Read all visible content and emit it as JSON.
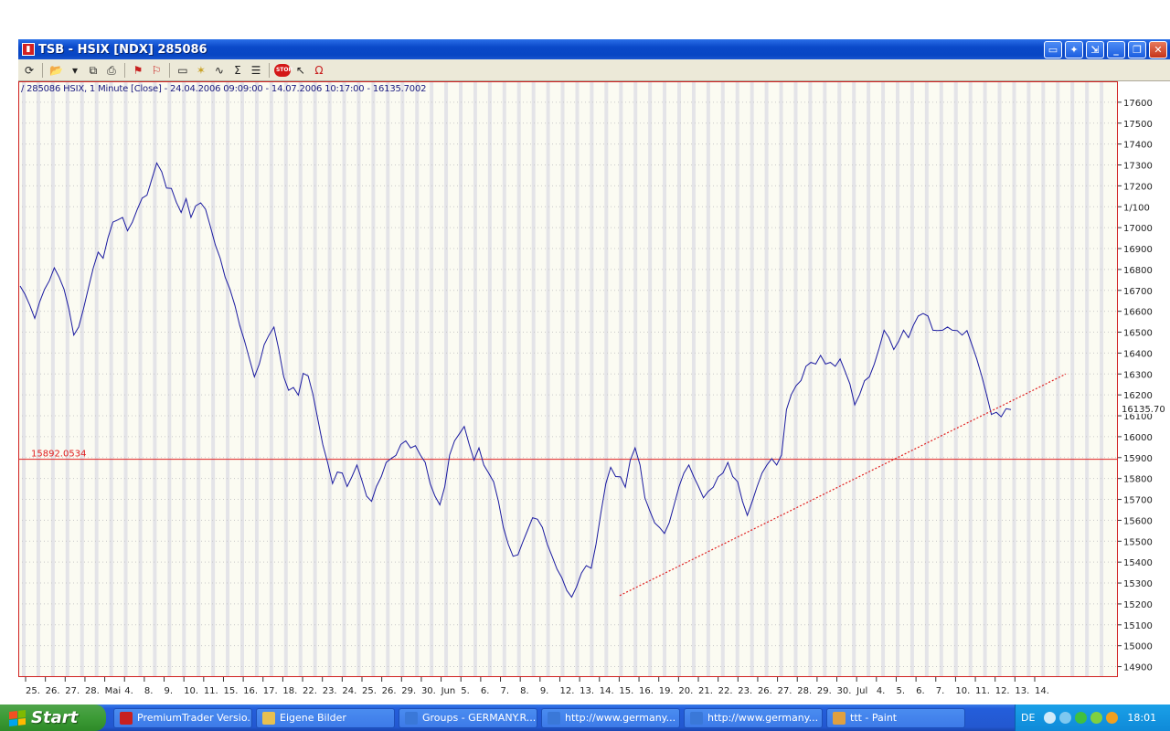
{
  "window": {
    "title": "TSB - HSIX [NDX] 285086",
    "buttons": [
      "minimize",
      "restore",
      "close"
    ]
  },
  "toolbar": {
    "icons": [
      "refresh-icon",
      "open-folder-icon",
      "save-icon",
      "copy-icon",
      "print-icon",
      "flag-icon",
      "flag-icon",
      "layout-icon",
      "indicator-icon",
      "studies-icon",
      "sum-icon",
      "properties-icon",
      "stop-icon",
      "cursor-icon",
      "magnet-icon"
    ],
    "stop_label": "STOP"
  },
  "chart_header": "/ 285086 HSIX, 1 Minute [Close] - 24.04.2006 09:09:00 - 14.07.2006 10:17:00 - 16135.7002",
  "chart_data": {
    "type": "line",
    "title": "285086 HSIX, 1 Minute [Close] - 24.04.2006 09:09:00 - 14.07.2006 10:17:00 - 16135.7002",
    "ylim": [
      14850,
      17700
    ],
    "y_ticks": [
      17600,
      17500,
      17400,
      17300,
      17200,
      17100,
      17000,
      16900,
      16800,
      16700,
      16600,
      16500,
      16400,
      16300,
      16200,
      16100,
      16000,
      15900,
      15800,
      15700,
      15600,
      15500,
      15400,
      15300,
      15200,
      15100,
      15000,
      14900
    ],
    "y_tick_labels": [
      "17600",
      "17500",
      "17400",
      "17300",
      "17200",
      "1/100",
      "17000",
      "16900",
      "16800",
      "16700",
      "16600",
      "16500",
      "16400",
      "16300",
      "16200",
      "16100",
      "16000",
      "15900",
      "15800",
      "15700",
      "15600",
      "15500",
      "15400",
      "15300",
      "15200",
      "15100",
      "15000",
      "14900"
    ],
    "x_tick_labels": [
      "25.",
      "26.",
      "27.",
      "28.",
      "Mai",
      "4.",
      "8.",
      "9.",
      "10.",
      "11.",
      "15.",
      "16.",
      "17.",
      "18.",
      "22.",
      "23.",
      "24.",
      "25.",
      "26.",
      "29.",
      "30.",
      "Jun",
      "5.",
      "6.",
      "7.",
      "8.",
      "9.",
      "12.",
      "13.",
      "14.",
      "15.",
      "16.",
      "19.",
      "20.",
      "21.",
      "22.",
      "23.",
      "26.",
      "27.",
      "28.",
      "29.",
      "30.",
      "Jul",
      "4.",
      "5.",
      "6.",
      "7.",
      "10.",
      "11.",
      "12.",
      "13.",
      "14."
    ],
    "series": [
      {
        "color": "#1a1aa0",
        "values": [
          16730,
          16680,
          16620,
          16580,
          16640,
          16700,
          16760,
          16820,
          16780,
          16700,
          16600,
          16480,
          16540,
          16620,
          16720,
          16820,
          16880,
          16860,
          16960,
          17040,
          17020,
          17060,
          17000,
          17040,
          17080,
          17140,
          17160,
          17220,
          17300,
          17280,
          17200,
          17180,
          17120,
          17080,
          17140,
          17060,
          17100,
          17120,
          17080,
          17020,
          16920,
          16860,
          16780,
          16700,
          16620,
          16520,
          16460,
          16380,
          16300,
          16360,
          16440,
          16480,
          16540,
          16420,
          16300,
          16220,
          16240,
          16200,
          16320,
          16280,
          16200,
          16100,
          15960,
          15860,
          15780,
          15820,
          15840,
          15760,
          15820,
          15880,
          15800,
          15720,
          15680,
          15760,
          15820,
          15860,
          15880,
          15920,
          15960,
          15980,
          15940,
          15960,
          15900,
          15860,
          15780,
          15720,
          15660,
          15760,
          15900,
          15980,
          16020,
          16040,
          15960,
          15900,
          15940,
          15880,
          15840,
          15780,
          15680,
          15560,
          15480,
          15440,
          15420,
          15500,
          15560,
          15600,
          15620,
          15560,
          15480,
          15440,
          15380,
          15320,
          15260,
          15240,
          15280,
          15340,
          15400,
          15360,
          15480,
          15620,
          15780,
          15840,
          15820,
          15800,
          15760,
          15900,
          15940,
          15880,
          15700,
          15660,
          15600,
          15560,
          15540,
          15580,
          15660,
          15760,
          15840,
          15880,
          15820,
          15760,
          15700,
          15740,
          15760,
          15800,
          15840,
          15860,
          15820,
          15780,
          15680,
          15640,
          15680,
          15760,
          15840,
          15880,
          15880,
          15880,
          15900,
          16140,
          16200,
          16240,
          16280,
          16320,
          16340,
          16360,
          16380,
          16360,
          16340,
          16320,
          16360,
          16300,
          16260,
          16160,
          16200,
          16260,
          16300,
          16360,
          16420,
          16500,
          16480,
          16420,
          16460,
          16500,
          16480,
          16520,
          16560,
          16600,
          16560,
          16500,
          16520,
          16500,
          16540,
          16500,
          16520,
          16480,
          16520,
          16440,
          16360,
          16280,
          16200,
          16120,
          16100,
          16080,
          16120,
          16140
        ]
      }
    ],
    "horizontal_lines": [
      {
        "value": 15892.0534,
        "label": "15892.0534",
        "color": "#e02020"
      }
    ],
    "trendline": {
      "color": "#e02020",
      "style": "dotted",
      "start_value": 15240,
      "end_value": 16300
    },
    "last_value_label": "16135.70",
    "grid": true
  },
  "taskbar": {
    "start_label": "Start",
    "items": [
      {
        "label": "PremiumTrader Versio...",
        "icon": "premiumtrader-icon",
        "color": "#c82020"
      },
      {
        "label": "Eigene Bilder",
        "icon": "folder-icon",
        "color": "#e8c050"
      },
      {
        "label": "Groups - GERMANY.R...",
        "icon": "ie-icon",
        "color": "#3a78d8"
      },
      {
        "label": "http://www.germany...",
        "icon": "ie-icon",
        "color": "#3a78d8"
      },
      {
        "label": "http://www.germany...",
        "icon": "ie-icon",
        "color": "#3a78d8"
      },
      {
        "label": "ttt - Paint",
        "icon": "paint-icon",
        "color": "#e0a040"
      }
    ],
    "language": "DE",
    "clock": "18:01"
  }
}
